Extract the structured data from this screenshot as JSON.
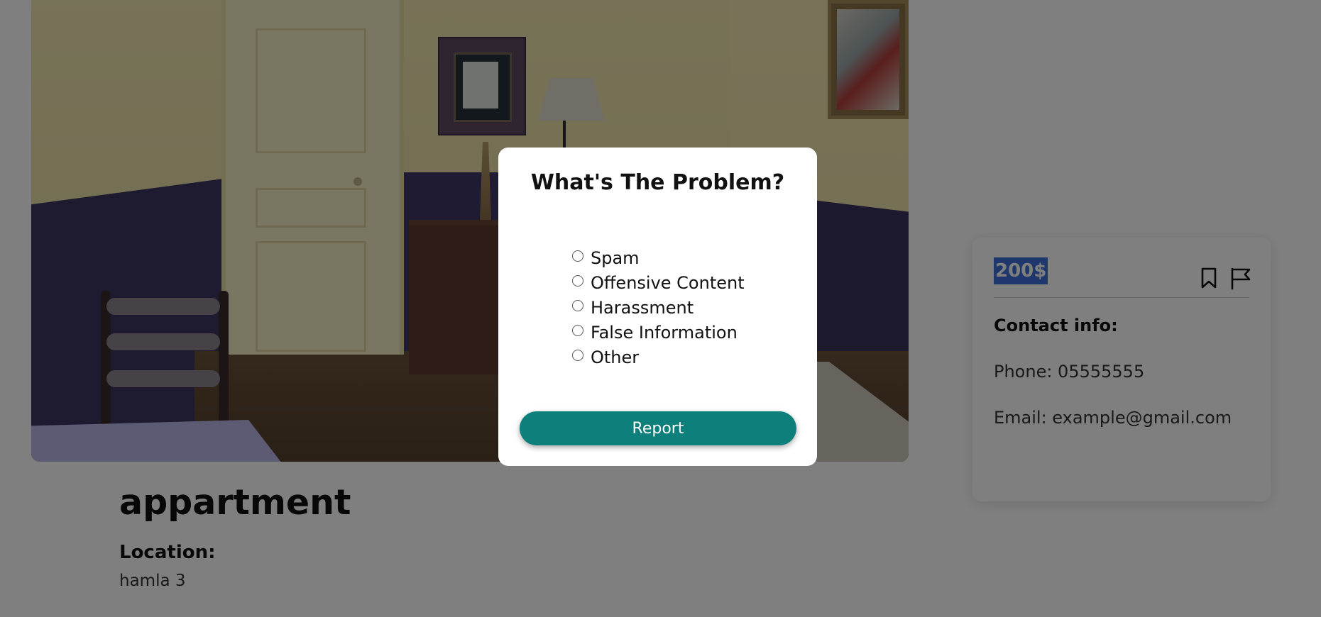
{
  "listing": {
    "title": "appartment",
    "location_label": "Location:",
    "location_value": "hamla 3"
  },
  "card": {
    "price": "200$",
    "bookmark_icon": "bookmark-icon",
    "flag_icon": "flag-icon",
    "contact_label": "Contact info:",
    "phone": "Phone: 05555555",
    "email": "Email: example@gmail.com"
  },
  "modal": {
    "title": "What's The Problem?",
    "options": [
      {
        "label": "Spam"
      },
      {
        "label": "Offensive Content"
      },
      {
        "label": "Harassment"
      },
      {
        "label": "False Information"
      },
      {
        "label": "Other"
      }
    ],
    "submit_label": "Report",
    "accent_color": "#0d807c"
  },
  "colors": {
    "overlay": "rgba(0,0,0,0.5)",
    "price_highlight": "#3d6fd9"
  }
}
